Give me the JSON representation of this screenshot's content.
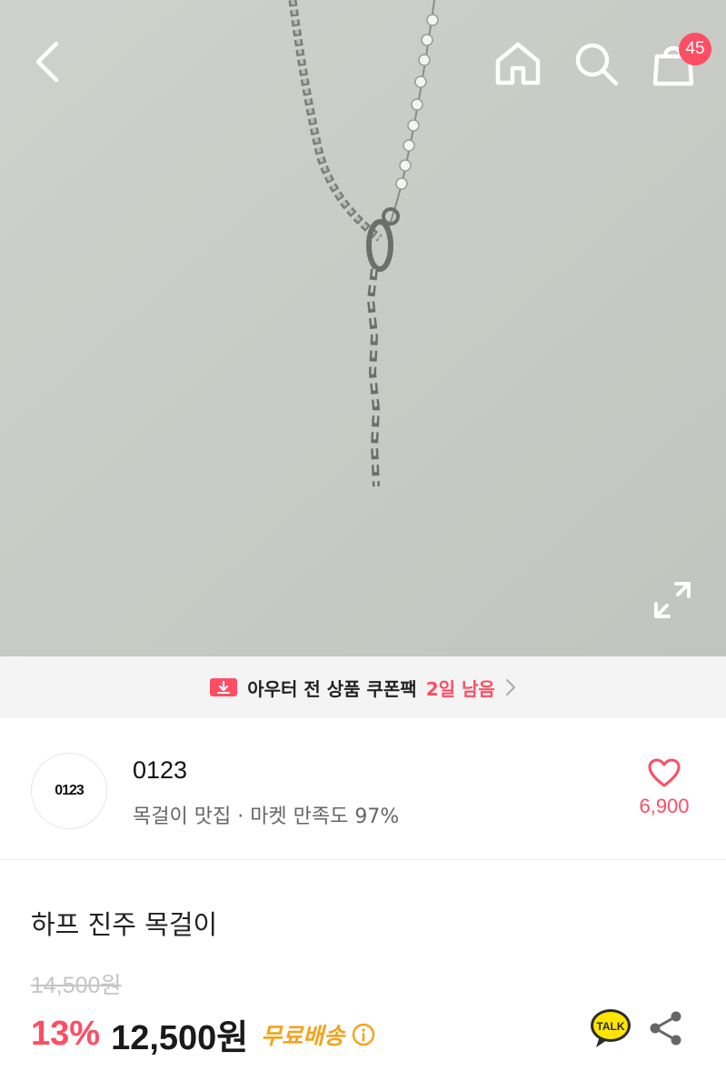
{
  "header": {
    "cart_count": "45"
  },
  "icons": {
    "back": "chevron-left-icon",
    "home": "home-icon",
    "search": "search-icon",
    "cart": "shopping-bag-icon",
    "expand": "expand-icon",
    "coupon": "coupon-icon",
    "favorite": "heart-icon",
    "info": "info-icon",
    "talk": "kakaotalk-icon",
    "share": "share-icon"
  },
  "coupon_banner": {
    "text": "아우터 전 상품 쿠폰팩",
    "remaining": "2일 남음"
  },
  "seller": {
    "logo_text": "0123",
    "name": "0123",
    "tag": "목걸이 맛집",
    "separator": " · ",
    "satisfaction": "마켓 만족도 97%",
    "favorites": "6,900"
  },
  "product": {
    "title": "하프 진주 목걸이",
    "original_price": "14,500원",
    "discount": "13%",
    "price": "12,500원",
    "shipping": "무료배송",
    "talk_label": "TALK"
  },
  "colors": {
    "accent": "#ff4d64",
    "shipping": "#f5a31a",
    "talk": "#fee500"
  }
}
